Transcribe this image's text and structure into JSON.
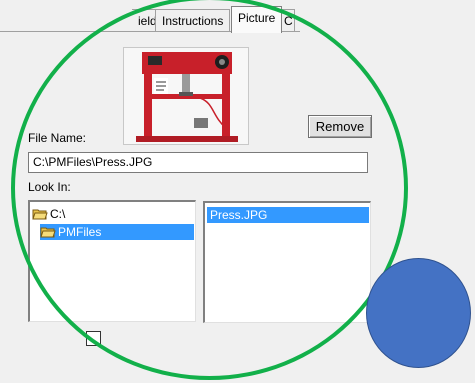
{
  "tabs": [
    {
      "label": "ields"
    },
    {
      "label": "Instructions"
    },
    {
      "label": "Picture"
    },
    {
      "label": "C"
    }
  ],
  "active_tab": "Picture",
  "picture": {
    "icon": "hydraulic-press-photo",
    "colors": {
      "frame": "#c8202a",
      "dark": "#2a2a2a"
    }
  },
  "remove_label": "Remove",
  "file_name": {
    "label": "File Name:",
    "value": "C:\\PMFiles\\Press.JPG"
  },
  "look_in": {
    "label": "Look In:"
  },
  "directories": [
    {
      "label": "C:\\",
      "icon": "folder-open-icon",
      "selected": false
    },
    {
      "label": "PMFiles",
      "icon": "folder-open-icon",
      "selected": true
    }
  ],
  "files": [
    {
      "label": "Press.JPG",
      "selected": true
    }
  ],
  "overlay": {
    "ring_color": "#12b04a",
    "dot_color": "#4472c4"
  }
}
